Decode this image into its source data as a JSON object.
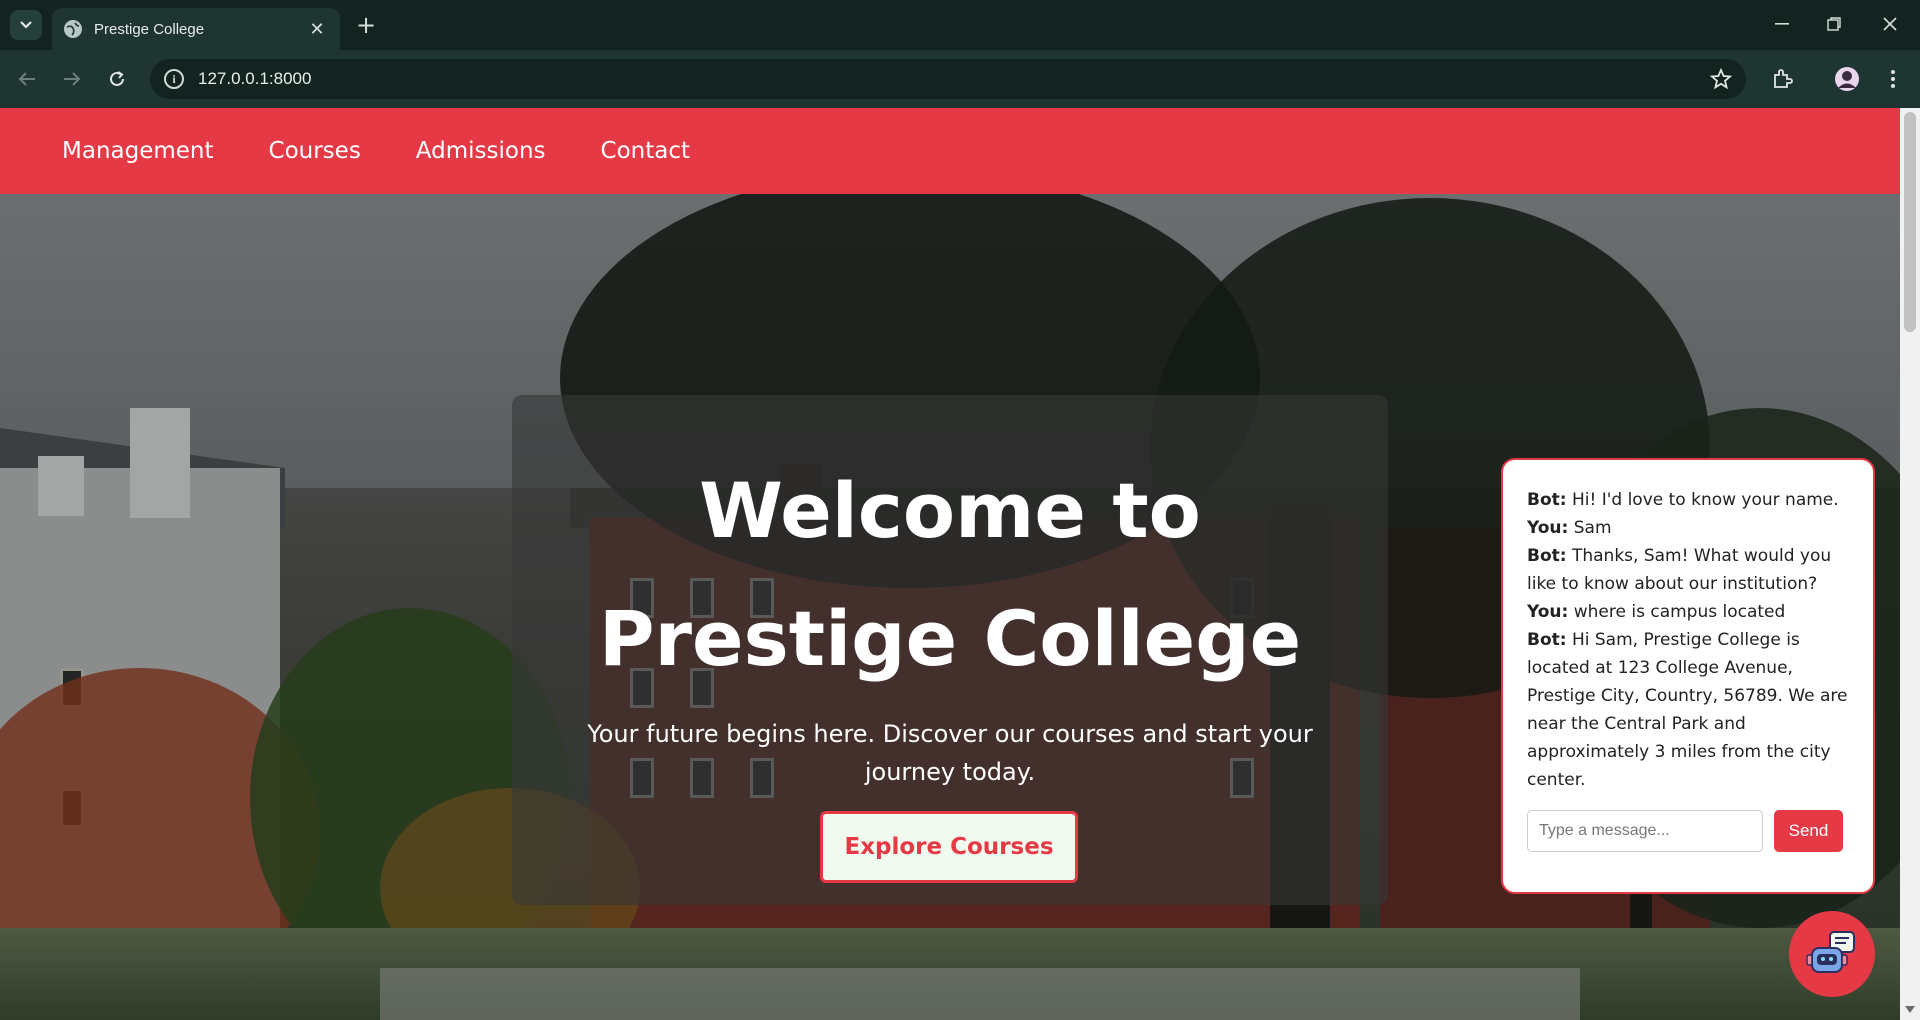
{
  "browser": {
    "tab_title": "Prestige College",
    "url": "127.0.0.1:8000"
  },
  "nav": {
    "items": [
      {
        "label": "Management"
      },
      {
        "label": "Courses"
      },
      {
        "label": "Admissions"
      },
      {
        "label": "Contact"
      }
    ]
  },
  "hero": {
    "title": "Welcome to Prestige College",
    "subtitle": "Your future begins here. Discover our courses and start your journey today.",
    "cta_label": "Explore Courses"
  },
  "chat": {
    "messages": [
      {
        "sender": "Bot:",
        "text": "Hi! I'd love to know your name."
      },
      {
        "sender": "You:",
        "text": "Sam"
      },
      {
        "sender": "Bot:",
        "text": "Thanks, Sam! What would you like to know about our institution?"
      },
      {
        "sender": "You:",
        "text": "where is campus located"
      },
      {
        "sender": "Bot:",
        "text": "Hi Sam, Prestige College is located at 123 College Avenue, Prestige City, Country, 56789. We are near the Central Park and approximately 3 miles from the city center."
      }
    ],
    "input_placeholder": "Type a message...",
    "send_label": "Send"
  },
  "colors": {
    "brand": "#e63946",
    "cta_background": "#f1faee"
  },
  "icons": [
    "tab-search-icon",
    "globe-icon",
    "close-icon",
    "plus-icon",
    "minimize-icon",
    "restore-icon",
    "window-close-icon",
    "back-icon",
    "forward-icon",
    "reload-icon",
    "info-icon",
    "star-icon",
    "extensions-icon",
    "profile-avatar",
    "menu-kebab-icon",
    "chatbot-icon"
  ]
}
